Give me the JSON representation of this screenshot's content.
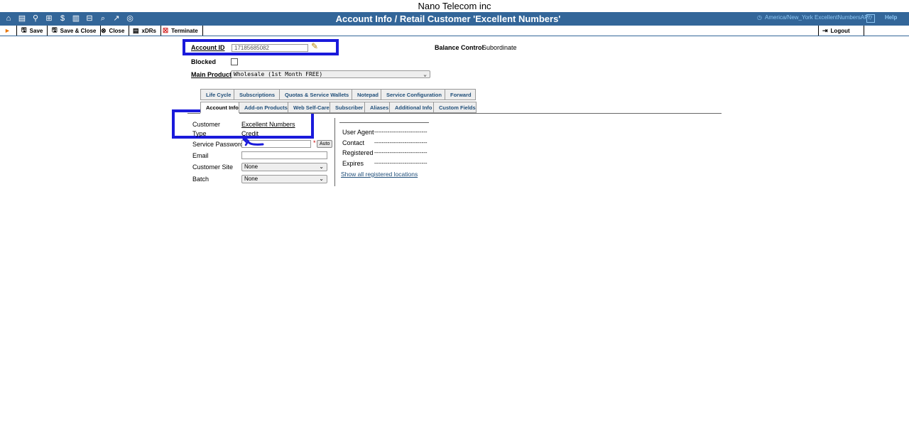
{
  "company": "Nano Telecom inc",
  "titlebar": {
    "icons": [
      "home-icon",
      "list-icon",
      "person-icon",
      "grid-icon",
      "dollar-icon",
      "chart-icon",
      "tree-icon",
      "search-icon",
      "trend-icon",
      "globe-icon"
    ],
    "title": "Account Info / Retail Customer 'Excellent Numbers'",
    "timezone": "America/New_York",
    "user": "ExcellentNumbersAPI",
    "help": "Help"
  },
  "toolbar": {
    "save": "Save",
    "save_close": "Save & Close",
    "close": "Close",
    "xdrs": "xDRs",
    "terminate": "Terminate",
    "logout": "Logout"
  },
  "account": {
    "id_label": "Account ID",
    "id_value": "17185685082",
    "balance_label": "Balance Control",
    "balance_value": "Subordinate",
    "blocked_label": "Blocked",
    "product_label": "Main Product",
    "product_value": "Wholesale (1st Month FREE)"
  },
  "tabs_row1": [
    "Life Cycle",
    "Subscriptions",
    "Quotas & Service Wallets",
    "Notepad",
    "Service Configuration",
    "Forward"
  ],
  "tabs_row2": [
    "Account Info",
    "Add-on Products",
    "Web Self-Care",
    "Subscriber",
    "Aliases",
    "Additional Info",
    "Custom Fields"
  ],
  "info": {
    "customer_label": "Customer",
    "customer_value": "Excellent Numbers",
    "type_label": "Type",
    "type_value": "Credit",
    "password_label": "Service Password",
    "auto_button": "Auto",
    "email_label": "Email",
    "site_label": "Customer Site",
    "site_value": "None",
    "batch_label": "Batch",
    "batch_value": "None"
  },
  "registration": {
    "user_agent_label": "User Agent",
    "contact_label": "Contact",
    "registered_label": "Registered",
    "expires_label": "Expires",
    "placeholder": "----------------------------",
    "show_all": "Show all registered locations"
  }
}
